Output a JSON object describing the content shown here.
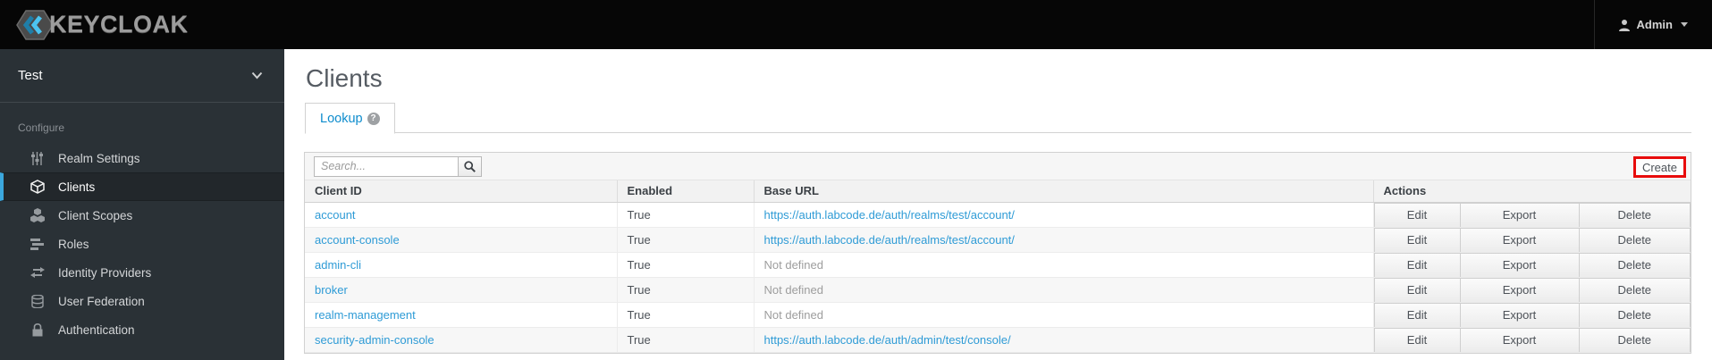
{
  "topbar": {
    "brand": "KEYCLOAK",
    "user_label": "Admin"
  },
  "sidebar": {
    "realm": "Test",
    "section_label": "Configure",
    "items": [
      {
        "label": "Realm Settings"
      },
      {
        "label": "Clients"
      },
      {
        "label": "Client Scopes"
      },
      {
        "label": "Roles"
      },
      {
        "label": "Identity Providers"
      },
      {
        "label": "User Federation"
      },
      {
        "label": "Authentication"
      }
    ]
  },
  "main": {
    "title": "Clients",
    "tab_label": "Lookup",
    "help_glyph": "?",
    "search_placeholder": "Search...",
    "create_label": "Create",
    "table": {
      "headers": [
        "Client ID",
        "Enabled",
        "Base URL",
        "Actions"
      ],
      "action_labels": [
        "Edit",
        "Export",
        "Delete"
      ],
      "rows": [
        {
          "client_id": "account",
          "enabled": "True",
          "base_url": "https://auth.labcode.de/auth/realms/test/account/",
          "url_defined": true
        },
        {
          "client_id": "account-console",
          "enabled": "True",
          "base_url": "https://auth.labcode.de/auth/realms/test/account/",
          "url_defined": true
        },
        {
          "client_id": "admin-cli",
          "enabled": "True",
          "base_url": "Not defined",
          "url_defined": false
        },
        {
          "client_id": "broker",
          "enabled": "True",
          "base_url": "Not defined",
          "url_defined": false
        },
        {
          "client_id": "realm-management",
          "enabled": "True",
          "base_url": "Not defined",
          "url_defined": false
        },
        {
          "client_id": "security-admin-console",
          "enabled": "True",
          "base_url": "https://auth.labcode.de/auth/admin/test/console/",
          "url_defined": true
        }
      ]
    }
  },
  "colors": {
    "link_blue": "#2e9bd6",
    "active_nav_blue": "#3ba7dd",
    "annotation_red": "#e80c0c",
    "topbar_black": "#060606",
    "sidebar_dark": "#2a3136"
  }
}
